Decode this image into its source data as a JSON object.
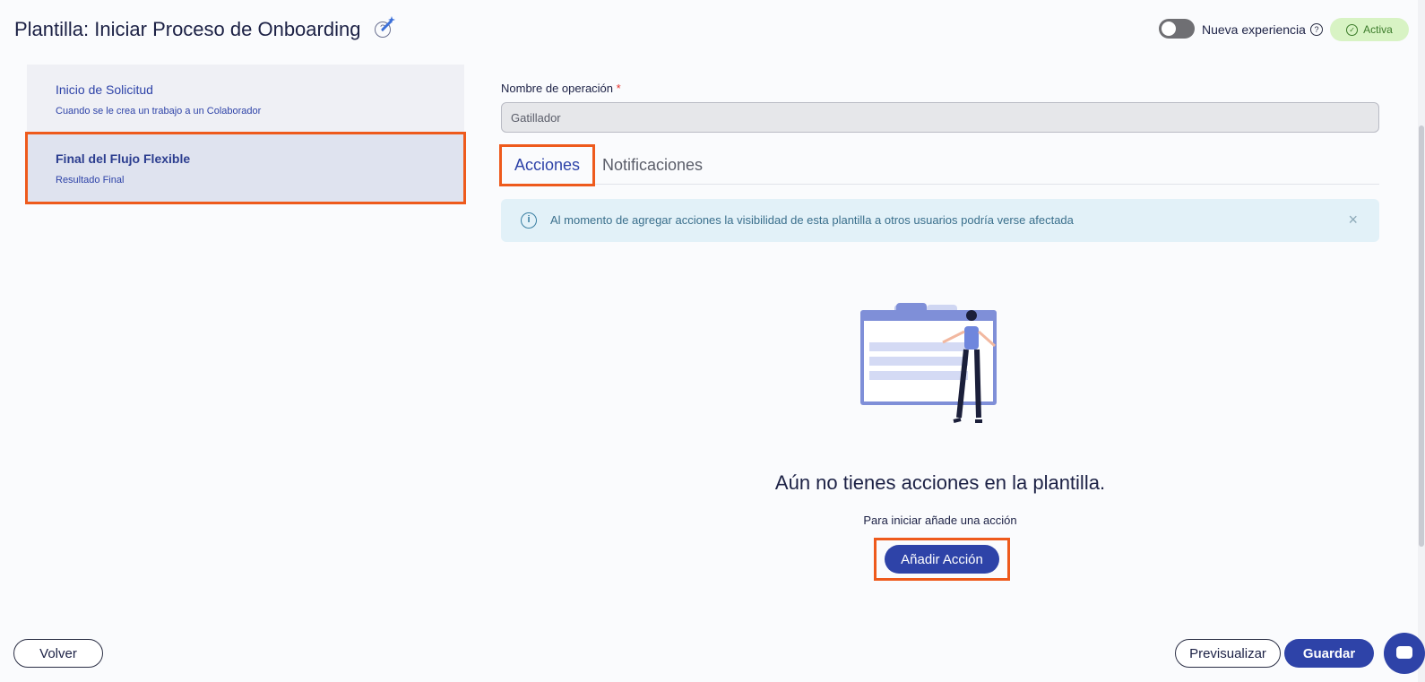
{
  "header": {
    "title": "Plantilla: Iniciar Proceso de Onboarding",
    "title_help": "?",
    "toggle_label": "Nueva experiencia",
    "toggle_help": "?",
    "status": "Activa"
  },
  "steps": [
    {
      "title": "Inicio de Solicitud",
      "subtitle": "Cuando se le crea un trabajo a un Colaborador"
    },
    {
      "title": "Final del Flujo Flexible",
      "subtitle": "Resultado Final"
    }
  ],
  "form": {
    "label": "Nombre de operación",
    "required_mark": "*",
    "value": "Gatillador"
  },
  "tabs": {
    "active": "Acciones",
    "inactive": "Notificaciones"
  },
  "alert": {
    "icon": "i",
    "text": "Al momento de agregar acciones la visibilidad de esta plantilla a otros usuarios podría verse afectada",
    "close": "×"
  },
  "empty_state": {
    "title": "Aún no tienes acciones en la plantilla.",
    "subtitle": "Para iniciar añade una acción",
    "button": "Añadir Acción"
  },
  "footer": {
    "back": "Volver",
    "preview": "Previsualizar",
    "save": "Guardar"
  },
  "colors": {
    "primary": "#2e43a8",
    "highlight": "#ee5a1c",
    "status_bg": "#d8f3c4"
  }
}
